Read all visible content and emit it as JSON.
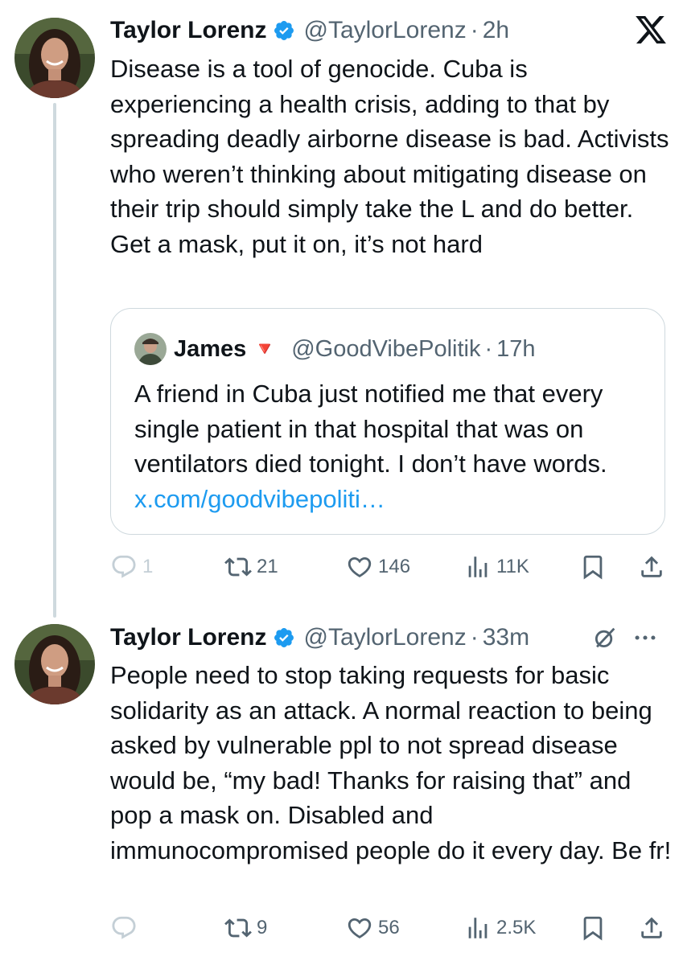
{
  "brand": {
    "logo": "x-logo-icon",
    "accent": "#1d9bf0",
    "verified_color": "#1d9bf0"
  },
  "tweets": [
    {
      "author": {
        "name": "Taylor Lorenz",
        "handle": "@TaylorLorenz",
        "verified": true
      },
      "time": "2h",
      "text": "Disease is a tool of genocide. Cuba is experiencing a health crisis, adding to that by spreading deadly airborne disease is bad. Activists who weren’t thinking about mitigating disease on their trip should simply take the L and do better. Get a mask, put it on, it’s not hard",
      "quote": {
        "author": {
          "name": "James",
          "emoji": "🔻",
          "handle": "@GoodVibePolitik"
        },
        "time": "17h",
        "text": "A friend in Cuba just notified me that every single patient in that hospital that was on ventilators died tonight. I don’t have words.",
        "link": "x.com/goodvibepoliti…"
      },
      "metrics": {
        "replies": "1",
        "reposts": "21",
        "likes": "146",
        "views": "11K"
      }
    },
    {
      "author": {
        "name": "Taylor Lorenz",
        "handle": "@TaylorLorenz",
        "verified": true
      },
      "time": "33m",
      "text": "People need to stop taking requests for basic solidarity as an attack. A normal reaction to being asked by vulnerable ppl to not spread disease would be, “my bad! Thanks for raising that” and pop a mask on. Disabled and immunocompromised people do it every day. Be fr!",
      "metrics": {
        "replies": "",
        "reposts": "9",
        "likes": "56",
        "views": "2.5K"
      }
    }
  ],
  "dot": "·"
}
